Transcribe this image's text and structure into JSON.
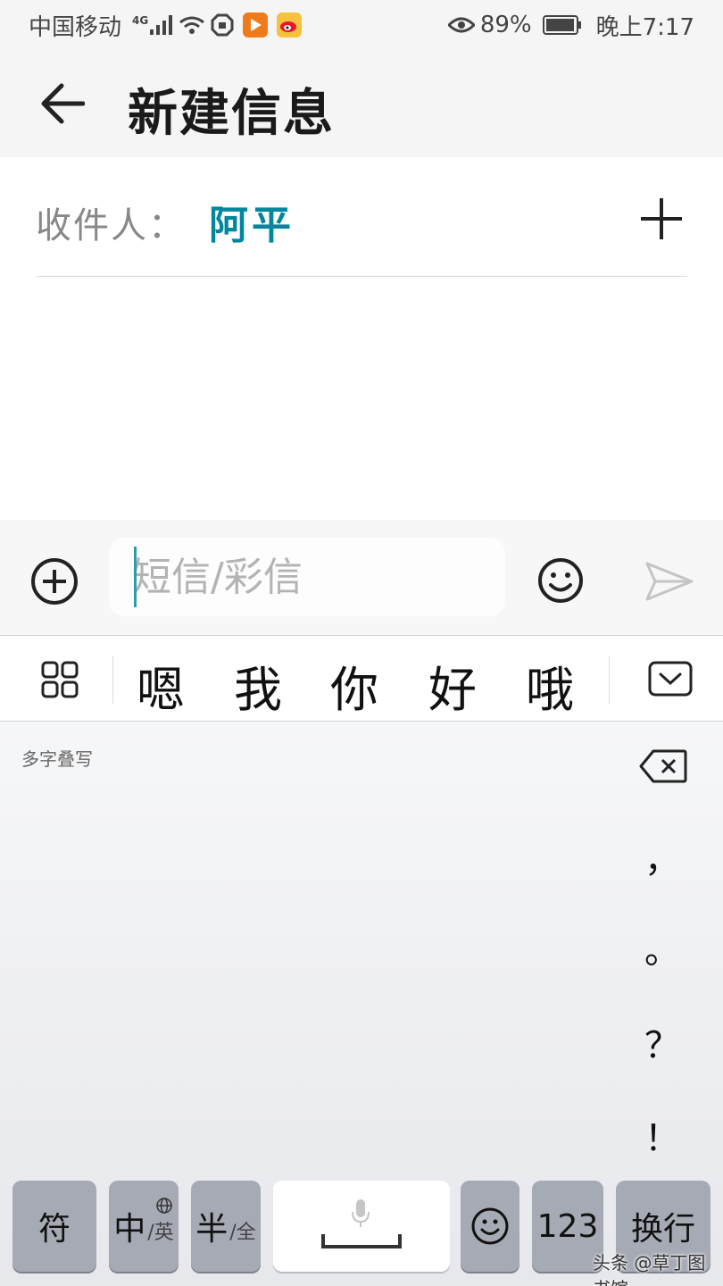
{
  "status_bar": {
    "carrier": "中国移动",
    "network": "4G",
    "battery": "89%",
    "time": "晚上7:17",
    "icons": [
      "signal-icon",
      "wifi-icon",
      "shield-icon",
      "video-app-icon",
      "weibo-icon",
      "eye-icon",
      "battery-icon"
    ]
  },
  "header": {
    "title": "新建信息",
    "back_icon": "back-arrow-icon"
  },
  "recipient": {
    "label": "收件人：",
    "name": "阿平",
    "add_icon": "plus-icon"
  },
  "compose": {
    "placeholder": "短信/彩信",
    "value": "",
    "attach_icon": "add-circle-icon",
    "emoji_icon": "smiley-icon",
    "send_icon": "send-icon"
  },
  "candidates": {
    "words": [
      "嗯",
      "我",
      "你",
      "好",
      "哦"
    ],
    "grid_icon": "grid-icon",
    "collapse_icon": "keyboard-collapse-icon"
  },
  "keyboard": {
    "mode_hint": "多字叠写",
    "punctuation": [
      "，",
      "。",
      "？",
      "！"
    ],
    "keys": {
      "symbols": "符",
      "lang_main": "中",
      "lang_sub": "/英",
      "width_main": "半",
      "width_sub": "/全",
      "numbers": "123",
      "enter": "换行"
    }
  },
  "watermark": "头条 @草丁图书馆",
  "colors": {
    "accent": "#00879e",
    "key_gray": "#a6aab4",
    "caret": "#2a9bb0"
  }
}
